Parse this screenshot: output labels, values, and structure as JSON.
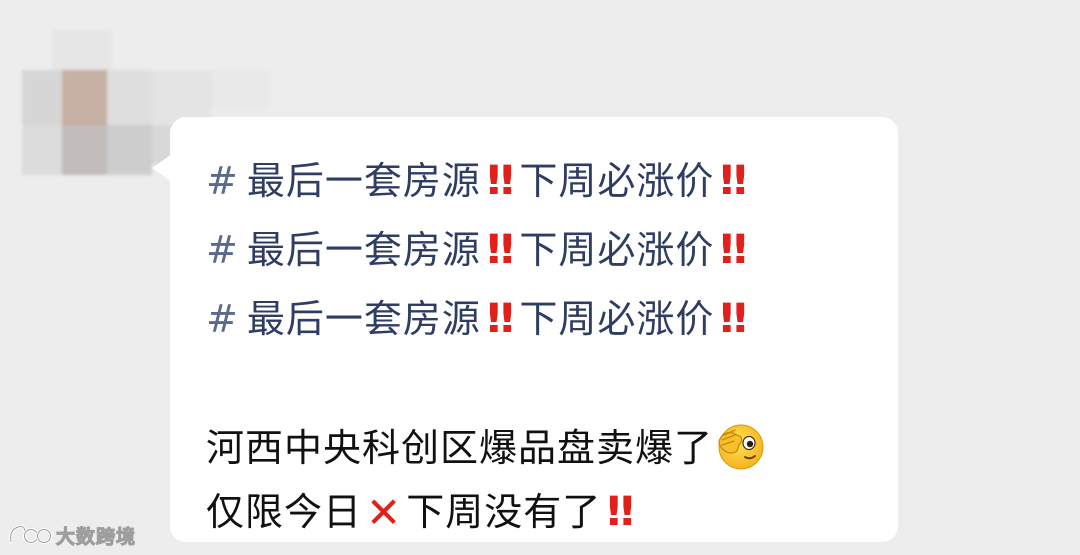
{
  "chat": {
    "message": {
      "tag_lines": [
        {
          "hash": "#",
          "text": "最后一套房源",
          "bang1": "!!",
          "text2": "下周必涨价",
          "bang2": "!!"
        },
        {
          "hash": "#",
          "text": "最后一套房源",
          "bang1": "!!",
          "text2": "下周必涨价",
          "bang2": "!!"
        },
        {
          "hash": "#",
          "text": "最后一套房源",
          "bang1": "!!",
          "text2": "下周必涨价",
          "bang2": "!!"
        }
      ],
      "line1": "河西中央科创区爆品盘卖爆了",
      "line1_emoji": "face-with-hand-over-eye-emoji",
      "line2_part1": "仅限今日",
      "line2_cross": "✕",
      "line2_part2": "下周没有了",
      "line2_bang": "!!"
    }
  },
  "watermark": {
    "text": "大数跨境"
  },
  "colors": {
    "background": "#ededed",
    "bubble": "#ffffff",
    "hashtag": "#2f3d62",
    "alert_red": "#e0201a",
    "text": "#111111"
  }
}
